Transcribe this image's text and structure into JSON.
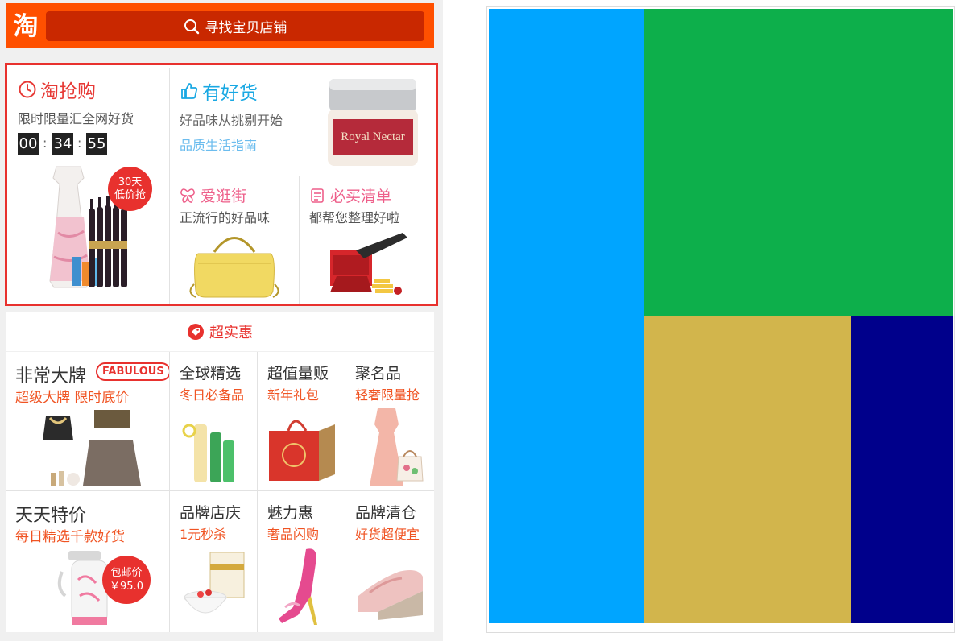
{
  "left": {
    "header": {
      "logo": "淘",
      "search_placeholder": "寻找宝贝店铺"
    },
    "taoqianggou": {
      "title": "淘抢购",
      "subtitle": "限时限量汇全网好货",
      "timer": {
        "h": "00",
        "m": "34",
        "s": "55"
      },
      "badge": [
        "30天",
        "低价抢"
      ]
    },
    "youhaohuo": {
      "title": "有好货",
      "subtitle": "好品味从挑剔开始",
      "link": "品质生活指南",
      "product_label": "Royal Nectar"
    },
    "aiguangjie": {
      "title": "爱逛街",
      "subtitle": "正流行的好品味"
    },
    "bimaiqingdan": {
      "title": "必买清单",
      "subtitle": "都帮您整理好啦"
    },
    "chaoshihui": {
      "title": "超实惠"
    },
    "grid": [
      {
        "title": "非常大牌",
        "subtitle": "超级大牌  限时底价",
        "tag": "FABULOUS"
      },
      {
        "title": "全球精选",
        "subtitle": "冬日必备品"
      },
      {
        "title": "超值量贩",
        "subtitle": "新年礼包"
      },
      {
        "title": "聚名品",
        "subtitle": "轻奢限量抢"
      },
      {
        "title": "天天特价",
        "subtitle": "每日精选千款好货",
        "badge": [
          "包邮价",
          "￥95.0"
        ]
      },
      {
        "title": "品牌店庆",
        "subtitle": "1元秒杀"
      },
      {
        "title": "魅力惠",
        "subtitle": "奢品闪购"
      },
      {
        "title": "品牌清仓",
        "subtitle": "好货超便宜"
      }
    ]
  },
  "right": {
    "colors": {
      "blue": "#00a5ff",
      "green": "#0daf4b",
      "gold": "#d2b54c",
      "navy": "#00008b"
    }
  }
}
